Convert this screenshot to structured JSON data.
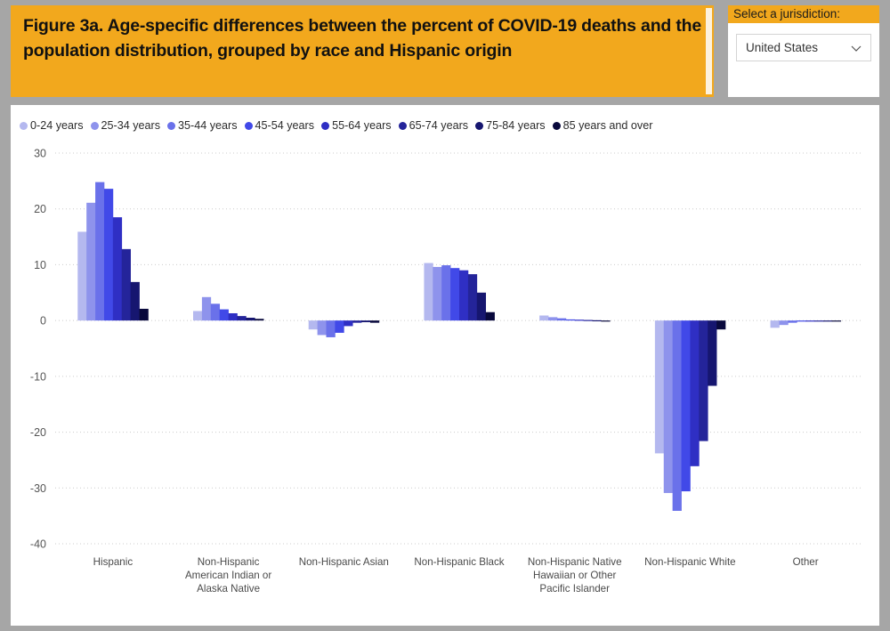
{
  "header": {
    "title": "Figure 3a. Age-specific differences between the percent of COVID-19 deaths and the population distribution, grouped by race and Hispanic origin",
    "accent_color": "#f2a81d"
  },
  "slicer": {
    "label": "Select a jurisdiction:",
    "selected": "United States",
    "icon": "chevron-down-icon"
  },
  "chart_data": {
    "type": "bar",
    "title": "Figure 3a. Age-specific differences between the percent of COVID-19 deaths and the population distribution, grouped by race and Hispanic origin",
    "xlabel": "",
    "ylabel": "",
    "ylim": [
      -40,
      30
    ],
    "yticks": [
      30,
      20,
      10,
      0,
      -10,
      -20,
      -30,
      -40
    ],
    "ytick_labels": [
      "30",
      "20",
      "10",
      "0",
      "-10",
      "-20",
      "-30",
      "-40"
    ],
    "grid": true,
    "legend_position": "top-left",
    "categories": [
      "Hispanic",
      "Non-Hispanic American Indian or Alaska Native",
      "Non-Hispanic Asian",
      "Non-Hispanic Black",
      "Non-Hispanic Native Hawaiian or Other Pacific Islander",
      "Non-Hispanic White",
      "Other"
    ],
    "category_lines": [
      [
        "Hispanic"
      ],
      [
        "Non-Hispanic",
        "American Indian or",
        "Alaska Native"
      ],
      [
        "Non-Hispanic Asian"
      ],
      [
        "Non-Hispanic Black"
      ],
      [
        "Non-Hispanic Native",
        "Hawaiian or Other",
        "Pacific Islander"
      ],
      [
        "Non-Hispanic White"
      ],
      [
        "Other"
      ]
    ],
    "series": [
      {
        "name": "0-24 years",
        "color": "#b4b8ef",
        "values": [
          15.9,
          1.7,
          -1.6,
          10.3,
          0.9,
          -23.8,
          -1.3
        ]
      },
      {
        "name": "25-34 years",
        "color": "#8e93ec",
        "values": [
          21.1,
          4.2,
          -2.6,
          9.6,
          0.6,
          -30.9,
          -0.8
        ]
      },
      {
        "name": "35-44 years",
        "color": "#6a71ea",
        "values": [
          24.8,
          3.0,
          -3.0,
          9.9,
          0.4,
          -34.1,
          -0.4
        ]
      },
      {
        "name": "45-54 years",
        "color": "#4149e8",
        "values": [
          23.6,
          2.0,
          -2.2,
          9.4,
          0.2,
          -30.6,
          -0.15
        ]
      },
      {
        "name": "55-64 years",
        "color": "#2f2fc4",
        "values": [
          18.5,
          1.3,
          -1.0,
          9.0,
          0.15,
          -26.1,
          -0.05
        ]
      },
      {
        "name": "65-74 years",
        "color": "#24249a",
        "values": [
          12.8,
          0.8,
          -0.4,
          8.3,
          0.1,
          -21.6,
          0.0
        ]
      },
      {
        "name": "75-84 years",
        "color": "#161670",
        "values": [
          6.9,
          0.5,
          -0.3,
          5.0,
          0.05,
          -11.7,
          0.0
        ]
      },
      {
        "name": "85 years and over",
        "color": "#09093c",
        "values": [
          2.1,
          0.3,
          -0.4,
          1.5,
          -0.05,
          -1.6,
          0.0
        ]
      }
    ]
  }
}
